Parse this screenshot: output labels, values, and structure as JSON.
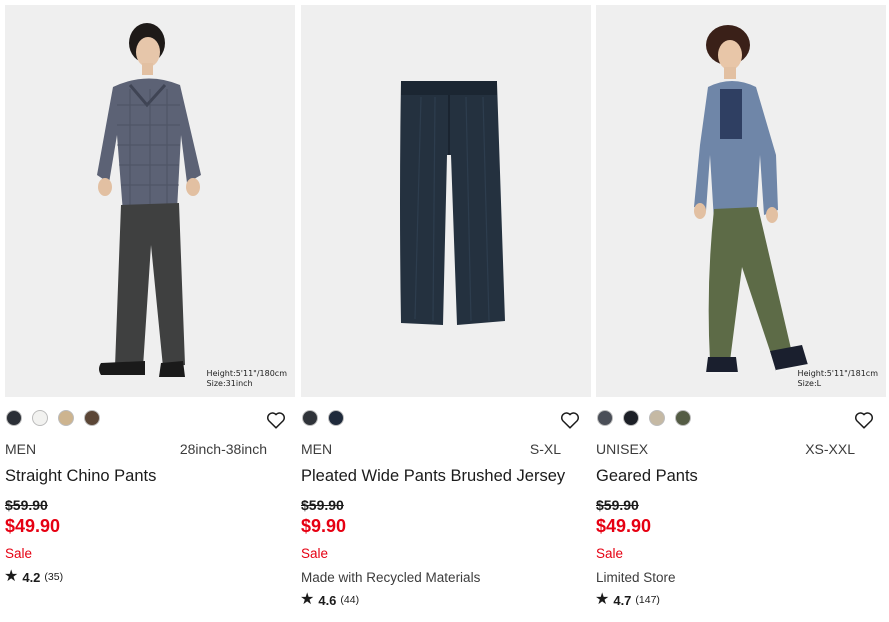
{
  "products": [
    {
      "photo_caption": [
        "Height:5'11\"/180cm",
        "Size:31inch"
      ],
      "swatches": [
        "#2b2f36",
        "#f2f2f0",
        "#cdb48f",
        "#5b4636"
      ],
      "gender": "MEN",
      "size_range": "28inch-38inch",
      "name": "Straight Chino Pants",
      "original_price": "$59.90",
      "price": "$49.90",
      "sale_label": "Sale",
      "flag": "",
      "rating": "4.2",
      "review_count": "(35)"
    },
    {
      "photo_caption": [],
      "swatches": [
        "#2f3339",
        "#1f2a3b"
      ],
      "gender": "MEN",
      "size_range": "S-XL",
      "name": "Pleated Wide Pants Brushed Jersey",
      "original_price": "$59.90",
      "price": "$9.90",
      "sale_label": "Sale",
      "flag": "Made with Recycled Materials",
      "rating": "4.6",
      "review_count": "(44)"
    },
    {
      "photo_caption": [
        "Height:5'11\"/181cm",
        "Size:L"
      ],
      "swatches": [
        "#4a4e57",
        "#1c1f26",
        "#c5b9a4",
        "#545c44"
      ],
      "gender": "UNISEX",
      "size_range": "XS-XXL",
      "name": "Geared Pants",
      "original_price": "$59.90",
      "price": "$49.90",
      "sale_label": "Sale",
      "flag": "Limited Store",
      "rating": "4.7",
      "review_count": "(147)"
    }
  ],
  "icons": {
    "favorite": "heart-outline-icon",
    "rating": "star-icon"
  },
  "colors": {
    "sale_red": "#e60012",
    "text": "#1b1b1b",
    "photo_bg": "#efefef"
  }
}
